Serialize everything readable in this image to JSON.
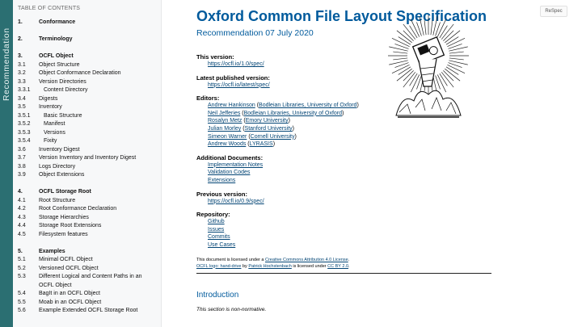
{
  "status_label": "Recommendation",
  "toc": {
    "title": "TABLE OF CONTENTS",
    "groups": [
      [
        {
          "num": "1.",
          "label": "Conformance",
          "lvl": "sec"
        }
      ],
      [
        {
          "num": "2.",
          "label": "Terminology",
          "lvl": "sec"
        }
      ],
      [
        {
          "num": "3.",
          "label": "OCFL Object",
          "lvl": "sec"
        },
        {
          "num": "3.1",
          "label": "Object Structure",
          "lvl": "sub"
        },
        {
          "num": "3.2",
          "label": "Object Conformance Declaration",
          "lvl": "sub"
        },
        {
          "num": "3.3",
          "label": "Version Directories",
          "lvl": "sub"
        },
        {
          "num": "3.3.1",
          "label": "Content Directory",
          "lvl": "sub3"
        },
        {
          "num": "3.4",
          "label": "Digests",
          "lvl": "sub"
        },
        {
          "num": "3.5",
          "label": "Inventory",
          "lvl": "sub"
        },
        {
          "num": "3.5.1",
          "label": "Basic Structure",
          "lvl": "sub3"
        },
        {
          "num": "3.5.2",
          "label": "Manifest",
          "lvl": "sub3"
        },
        {
          "num": "3.5.3",
          "label": "Versions",
          "lvl": "sub3"
        },
        {
          "num": "3.5.4",
          "label": "Fixity",
          "lvl": "sub3"
        },
        {
          "num": "3.6",
          "label": "Inventory Digest",
          "lvl": "sub"
        },
        {
          "num": "3.7",
          "label": "Version Inventory and Inventory Digest",
          "lvl": "sub"
        },
        {
          "num": "3.8",
          "label": "Logs Directory",
          "lvl": "sub"
        },
        {
          "num": "3.9",
          "label": "Object Extensions",
          "lvl": "sub"
        }
      ],
      [
        {
          "num": "4.",
          "label": "OCFL Storage Root",
          "lvl": "sec"
        },
        {
          "num": "4.1",
          "label": "Root Structure",
          "lvl": "sub"
        },
        {
          "num": "4.2",
          "label": "Root Conformance Declaration",
          "lvl": "sub"
        },
        {
          "num": "4.3",
          "label": "Storage Hierarchies",
          "lvl": "sub"
        },
        {
          "num": "4.4",
          "label": "Storage Root Extensions",
          "lvl": "sub"
        },
        {
          "num": "4.5",
          "label": "Filesystem features",
          "lvl": "sub"
        }
      ],
      [
        {
          "num": "5.",
          "label": "Examples",
          "lvl": "sec"
        },
        {
          "num": "5.1",
          "label": "Minimal OCFL Object",
          "lvl": "sub"
        },
        {
          "num": "5.2",
          "label": "Versioned OCFL Object",
          "lvl": "sub"
        },
        {
          "num": "5.3",
          "label": "Different Logical and Content Paths in an OCFL Object",
          "lvl": "sub"
        },
        {
          "num": "5.4",
          "label": "BagIt in an OCFL Object",
          "lvl": "sub"
        },
        {
          "num": "5.5",
          "label": "Moab in an OCFL Object",
          "lvl": "sub"
        },
        {
          "num": "5.6",
          "label": "Example Extended OCFL Storage Root",
          "lvl": "sub"
        }
      ]
    ]
  },
  "doc": {
    "title": "Oxford Common File Layout Specification",
    "subtitle": "Recommendation 07 July 2020",
    "this_version": {
      "label": "This version:",
      "url": "https://ocfl.io/1.0/spec/"
    },
    "latest": {
      "label": "Latest published version:",
      "url": "https://ocfl.io/latest/spec/"
    },
    "editors_label": "Editors:",
    "editors": [
      {
        "name": "Andrew Hankinson",
        "aff": "Bodleian Libraries, University of Oxford"
      },
      {
        "name": "Neil Jefferies",
        "aff": "Bodleian Libraries, University of Oxford"
      },
      {
        "name": "Rosalyn Metz",
        "aff": "Emory University"
      },
      {
        "name": "Julian Morley",
        "aff": "Stanford University"
      },
      {
        "name": "Simeon Warner",
        "aff": "Cornell University"
      },
      {
        "name": "Andrew Woods",
        "aff": "LYRASIS"
      }
    ],
    "additional_label": "Additional Documents:",
    "additional": [
      "Implementation Notes",
      "Validation Codes",
      "Extensions"
    ],
    "previous": {
      "label": "Previous version:",
      "url": "https://ocfl.io/0.9/spec/"
    },
    "repository_label": "Repository:",
    "repository": [
      "Github",
      "Issues",
      "Commits",
      "Use Cases"
    ],
    "license": {
      "l1_pre": "This document is licensed under a ",
      "l1_link": "Creative Commons Attribution 4.0 License",
      "l1_post": ".",
      "l2_link1": "OCFL logo: hand-drive",
      "l2_mid1": " by ",
      "l2_link2": "Patrick Hochstenbach",
      "l2_mid2": " is licensed under ",
      "l2_link3": "CC BY 2.0",
      "l2_post": "."
    },
    "intro_heading": "Introduction",
    "nonnormative": "This section is non-normative."
  },
  "respec_label": "ReSpec"
}
